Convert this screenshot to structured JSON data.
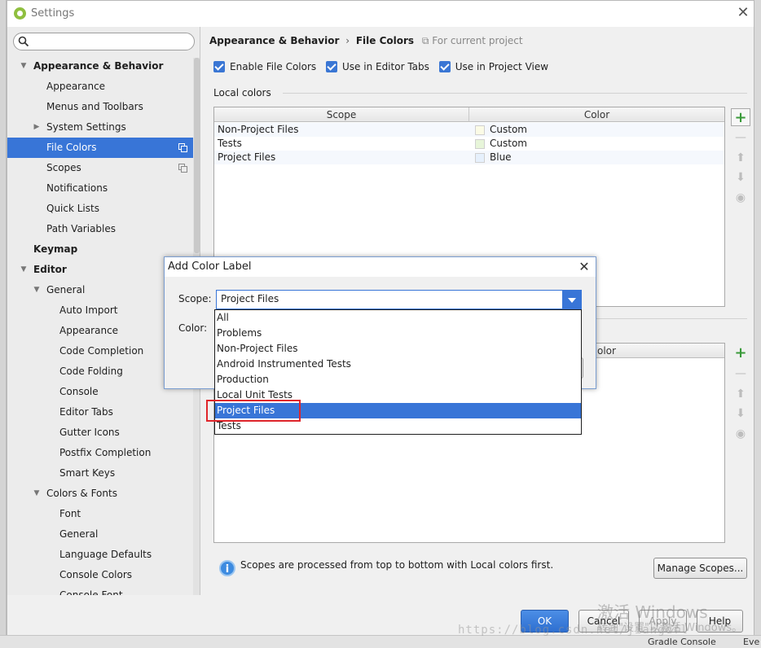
{
  "window": {
    "title": "Settings"
  },
  "sidebar": {
    "search_placeholder": "",
    "items": [
      {
        "label": "Appearance & Behavior",
        "level": 0,
        "bold": true,
        "arrow": "down"
      },
      {
        "label": "Appearance",
        "level": 1
      },
      {
        "label": "Menus and Toolbars",
        "level": 1
      },
      {
        "label": "System Settings",
        "level": 1,
        "arrow": "right"
      },
      {
        "label": "File Colors",
        "level": 1,
        "selected": true,
        "copy_icon": true
      },
      {
        "label": "Scopes",
        "level": 1,
        "copy_icon": true
      },
      {
        "label": "Notifications",
        "level": 1
      },
      {
        "label": "Quick Lists",
        "level": 1
      },
      {
        "label": "Path Variables",
        "level": 1
      },
      {
        "label": "Keymap",
        "level": 0,
        "bold": true
      },
      {
        "label": "Editor",
        "level": 0,
        "bold": true,
        "arrow": "down"
      },
      {
        "label": "General",
        "level": 1,
        "arrow": "down"
      },
      {
        "label": "Auto Import",
        "level": 2
      },
      {
        "label": "Appearance",
        "level": 2
      },
      {
        "label": "Code Completion",
        "level": 2
      },
      {
        "label": "Code Folding",
        "level": 2
      },
      {
        "label": "Console",
        "level": 2
      },
      {
        "label": "Editor Tabs",
        "level": 2
      },
      {
        "label": "Gutter Icons",
        "level": 2
      },
      {
        "label": "Postfix Completion",
        "level": 2
      },
      {
        "label": "Smart Keys",
        "level": 2
      },
      {
        "label": "Colors & Fonts",
        "level": 1,
        "arrow": "down"
      },
      {
        "label": "Font",
        "level": 2
      },
      {
        "label": "General",
        "level": 2
      },
      {
        "label": "Language Defaults",
        "level": 2
      },
      {
        "label": "Console Colors",
        "level": 2
      },
      {
        "label": "Console Font",
        "level": 2
      }
    ]
  },
  "breadcrumb": {
    "parent": "Appearance & Behavior",
    "separator": "›",
    "current": "File Colors",
    "project_note": "For current project"
  },
  "checkboxes": {
    "enable_file_colors": "Enable File Colors",
    "use_in_editor_tabs": "Use in Editor Tabs",
    "use_in_project_view": "Use in Project View"
  },
  "local_colors": {
    "label": "Local colors",
    "headers": {
      "scope": "Scope",
      "color": "Color"
    },
    "rows": [
      {
        "scope": "Non-Project Files",
        "color": "Custom",
        "swatch": "#fbfbe6"
      },
      {
        "scope": "Tests",
        "color": "Custom",
        "swatch": "#e7f5d9"
      },
      {
        "scope": "Project Files",
        "color": "Blue",
        "swatch": "#e6f0fc"
      }
    ]
  },
  "shared_table": {
    "color_header_partial": "olor"
  },
  "info_text": "Scopes are processed from top to bottom with Local colors first.",
  "buttons": {
    "manage_scopes": "Manage Scopes...",
    "ok": "OK",
    "cancel": "Cancel",
    "apply": "Apply",
    "help": "Help"
  },
  "dialog": {
    "title": "Add Color Label",
    "scope_label": "Scope:",
    "color_label": "Color:",
    "scope_value": "Project Files",
    "options": [
      "All",
      "Problems",
      "Non-Project Files",
      "Android Instrumented Tests",
      "Production",
      "Local Unit Tests",
      "Project Files",
      "Tests"
    ],
    "selected_index": 6
  },
  "watermark": {
    "line1": "激活 Windows",
    "line2": "转到\"设置\"以激活 Windows。",
    "url": "https://blog.csdn.net/jiangdfl"
  },
  "statusbar": {
    "gradle_console": "Gradle Console",
    "event": "Eve"
  },
  "colors": {
    "accent": "#3875d7",
    "highlight_box": "#e0262b",
    "add_green": "#3a9a3a"
  }
}
